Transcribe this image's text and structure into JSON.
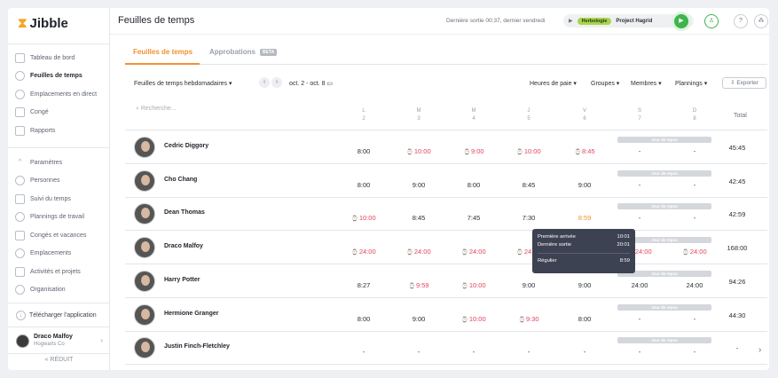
{
  "app": {
    "logo": "Jibble"
  },
  "sidebar": {
    "items": [
      {
        "label": "Tableau de bord",
        "icon": "dashboard-icon"
      },
      {
        "label": "Feuilles de temps",
        "icon": "clock-icon"
      },
      {
        "label": "Emplacements en direct",
        "icon": "location-icon"
      },
      {
        "label": "Congé",
        "icon": "calendar-icon"
      },
      {
        "label": "Rapports",
        "icon": "report-icon"
      },
      {
        "label": "Paramètres",
        "icon": "chevron-up-icon"
      },
      {
        "label": "Personnes",
        "icon": "people-icon"
      },
      {
        "label": "Suivi du temps",
        "icon": "time-tracking-icon"
      },
      {
        "label": "Plannings de travail",
        "icon": "schedule-icon"
      },
      {
        "label": "Congés et vacances",
        "icon": "holiday-icon"
      },
      {
        "label": "Emplacements",
        "icon": "pin-icon"
      },
      {
        "label": "Activités et projets",
        "icon": "tag-icon"
      },
      {
        "label": "Organisation",
        "icon": "gear-icon"
      }
    ],
    "download": "Télécharger l'application",
    "user": {
      "name": "Draco Malfoy",
      "org": "Hogwarts Co"
    },
    "collapse": "« RÉDUIT"
  },
  "topbar": {
    "title": "Feuilles de temps",
    "last_out": "Dernière sortie 00:37, dernier vendredi",
    "activity_tag": "Herbologie",
    "project": "Project Hagrid"
  },
  "tabs": {
    "timesheets": "Feuilles de temps",
    "approvals": "Approbations",
    "beta": "BETA"
  },
  "filters": {
    "type": "Feuilles de temps hebdomadaires",
    "range": "oct. 2 - oct. 8",
    "pay_hours": "Heures de paie",
    "groups": "Groupes",
    "members": "Membres",
    "schedules": "Plannings",
    "export": "Exporter"
  },
  "table": {
    "search_placeholder": "Recherche...",
    "days": [
      {
        "d": "L",
        "n": "2"
      },
      {
        "d": "M",
        "n": "3"
      },
      {
        "d": "M",
        "n": "4"
      },
      {
        "d": "J",
        "n": "5"
      },
      {
        "d": "V",
        "n": "6"
      },
      {
        "d": "S",
        "n": "7"
      },
      {
        "d": "D",
        "n": "8"
      }
    ],
    "total_label": "Total",
    "day_off_label": "Jour de repos",
    "rows": [
      {
        "name": "Cedric Diggory",
        "cells": [
          "8:00",
          "10:00",
          "9:00",
          "10:00",
          "8:45",
          "-",
          "-"
        ],
        "flags": [
          "",
          "r",
          "r",
          "r",
          "r",
          "",
          ""
        ],
        "total": "45:45",
        "dayoff": true
      },
      {
        "name": "Cho Chang",
        "cells": [
          "8:00",
          "9:00",
          "8:00",
          "8:45",
          "9:00",
          "-",
          "-"
        ],
        "flags": [
          "",
          "",
          "",
          "",
          "",
          "",
          ""
        ],
        "total": "42:45",
        "dayoff": true
      },
      {
        "name": "Dean Thomas",
        "cells": [
          "10:00",
          "8:45",
          "7:45",
          "7:30",
          "8:59",
          "-",
          "-"
        ],
        "flags": [
          "r",
          "",
          "",
          "",
          "o",
          "",
          ""
        ],
        "total": "42:59",
        "dayoff": true
      },
      {
        "name": "Draco Malfoy",
        "cells": [
          "24:00",
          "24:00",
          "24:00",
          "24:00",
          "",
          "24:00",
          "24:00"
        ],
        "flags": [
          "r",
          "r",
          "r",
          "r",
          "",
          "r",
          "r"
        ],
        "total": "168:00",
        "dayoff": true
      },
      {
        "name": "Harry Potter",
        "cells": [
          "8:27",
          "9:59",
          "10:00",
          "9:00",
          "9:00",
          "24:00",
          "24:00"
        ],
        "flags": [
          "",
          "r",
          "r",
          "",
          "",
          "",
          ""
        ],
        "total": "94:26",
        "dayoff": true
      },
      {
        "name": "Hermione Granger",
        "cells": [
          "8:00",
          "9:00",
          "10:00",
          "9:30",
          "8:00",
          "-",
          "-"
        ],
        "flags": [
          "",
          "",
          "r",
          "r",
          "",
          "",
          ""
        ],
        "total": "44:30",
        "dayoff": true
      },
      {
        "name": "Justin Finch-Fletchley",
        "cells": [
          "-",
          "-",
          "-",
          "-",
          "-",
          "-",
          "-"
        ],
        "flags": [
          "",
          "",
          "",
          "",
          "",
          "",
          ""
        ],
        "total": "-",
        "dayoff": true
      }
    ]
  },
  "tooltip": {
    "first_in_label": "Première arrivée",
    "first_in": "10:01",
    "last_out_label": "Dernière sortie",
    "last_out": "20:01",
    "regular_label": "Régulier",
    "regular": "8:59"
  },
  "colors": {
    "accent": "#f09232",
    "danger": "#e2445c",
    "success": "#3fb44d"
  }
}
